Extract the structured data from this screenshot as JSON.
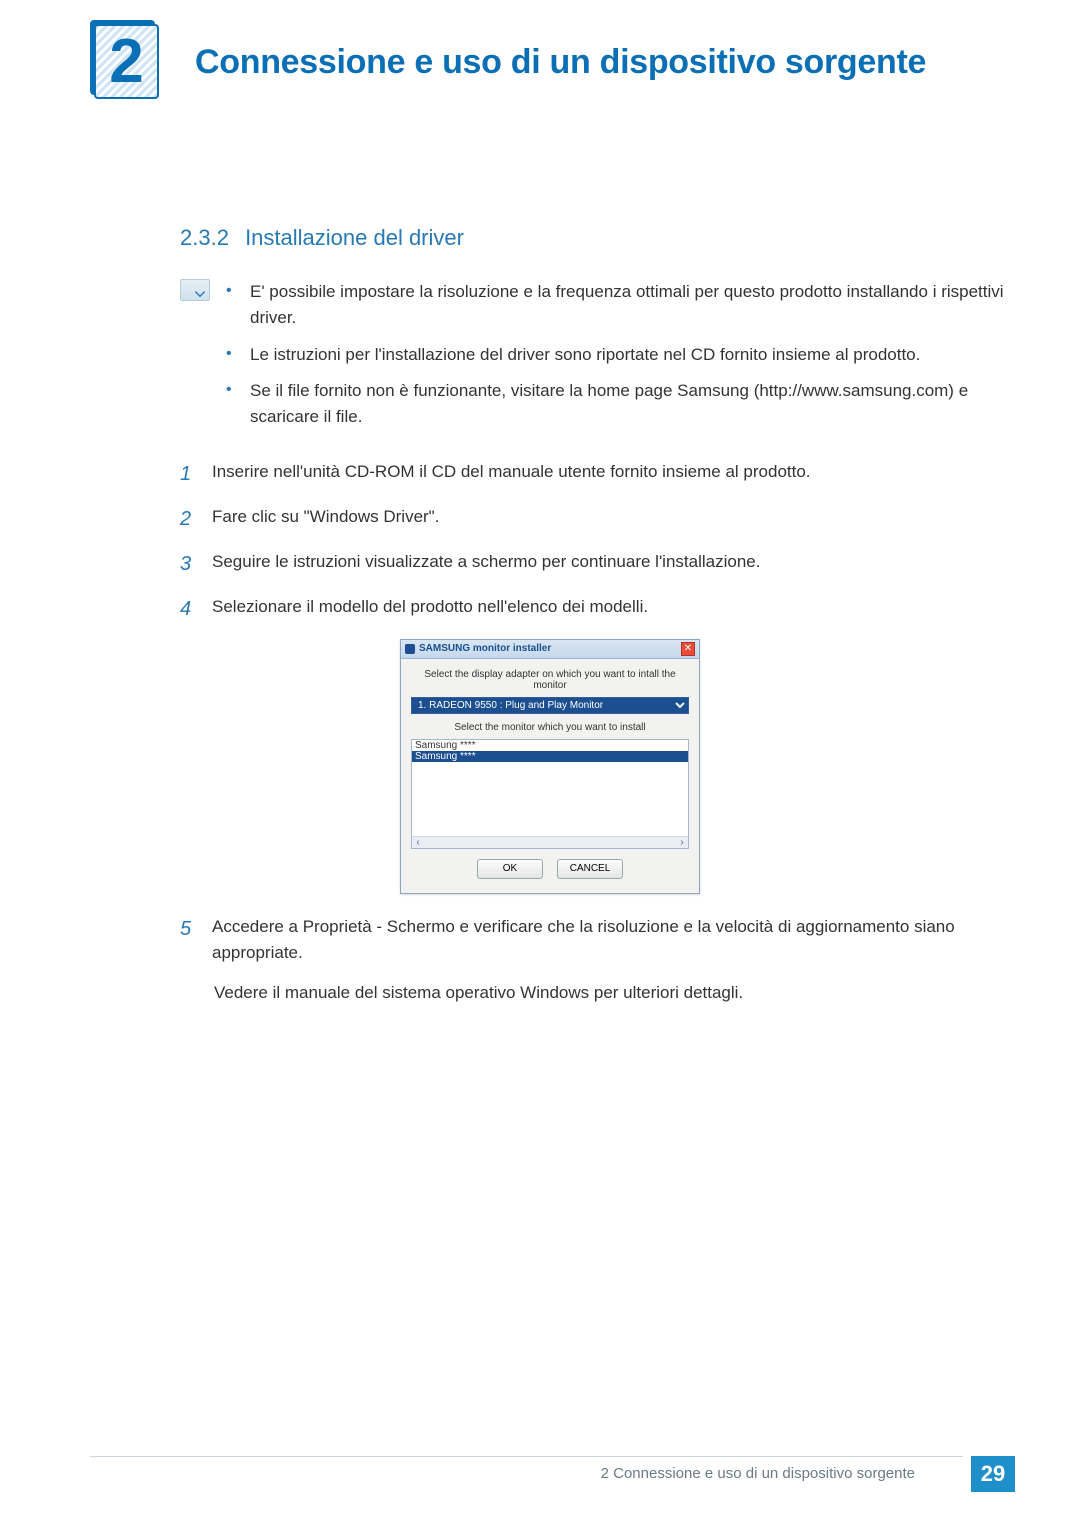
{
  "chapter": {
    "number": "2",
    "title": "Connessione e uso di un dispositivo sorgente"
  },
  "section": {
    "number": "2.3.2",
    "title": "Installazione del driver"
  },
  "notes": [
    "E' possibile impostare la risoluzione e la frequenza ottimali per questo prodotto installando i rispettivi driver.",
    "Le istruzioni per l'installazione del driver sono riportate nel CD fornito insieme al prodotto.",
    "Se il file fornito non è funzionante, visitare la home page Samsung (http://www.samsung.com) e scaricare il file."
  ],
  "steps": [
    "Inserire nell'unità CD-ROM il CD del manuale utente fornito insieme al prodotto.",
    "Fare clic su \"Windows Driver\".",
    "Seguire le istruzioni visualizzate a schermo per continuare l'installazione.",
    "Selezionare il modello del prodotto nell'elenco dei modelli.",
    "Accedere a Proprietà - Schermo e verificare che la risoluzione e la velocità di aggiornamento siano appropriate."
  ],
  "step_nums": [
    "1",
    "2",
    "3",
    "4",
    "5"
  ],
  "step5_extra": "Vedere il manuale del sistema operativo Windows per ulteriori dettagli.",
  "dialog": {
    "title": "SAMSUNG monitor installer",
    "label_adapter": "Select the display adapter on which you want to intall the monitor",
    "adapter_option": "1. RADEON 9550 : Plug and Play Monitor",
    "label_monitor": "Select the monitor which you want to install",
    "list_item_unselected": "Samsung ****",
    "list_item_selected": "Samsung ****",
    "ok": "OK",
    "cancel": "CANCEL",
    "close": "✕",
    "scroll_left": "‹",
    "scroll_right": "›"
  },
  "footer": {
    "text": "2 Connessione e uso di un dispositivo sorgente",
    "page": "29"
  }
}
